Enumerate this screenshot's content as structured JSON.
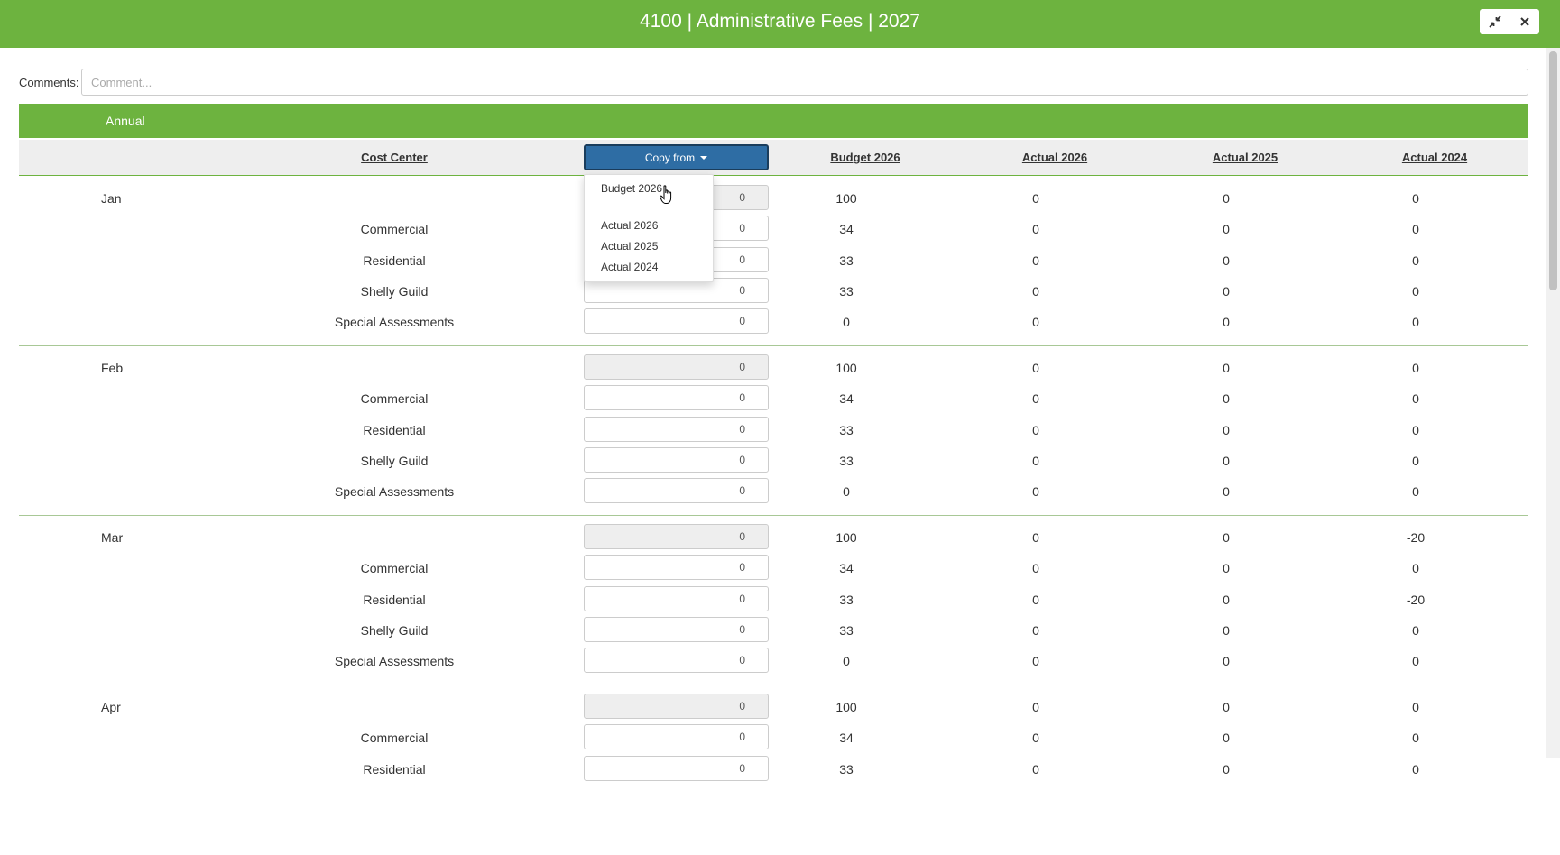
{
  "header": {
    "title": "4100 | Administrative Fees | 2027",
    "bg_color": "#6db33f",
    "minimize_icon": "compress-icon",
    "close_icon": "close-icon"
  },
  "comments": {
    "label": "Comments:",
    "placeholder": "Comment...",
    "value": ""
  },
  "section": {
    "label": "Annual"
  },
  "columns": {
    "cost_center": "Cost Center",
    "copy_from": "Copy from",
    "budget_2026": "Budget 2026",
    "actual_2026": "Actual 2026",
    "actual_2025": "Actual 2025",
    "actual_2024": "Actual 2024"
  },
  "copy_dropdown": {
    "items": [
      "Budget 2026",
      "Actual 2026",
      "Actual 2025",
      "Actual 2024"
    ]
  },
  "months": [
    {
      "month": "Jan",
      "rows": [
        {
          "cc": "",
          "input": "0",
          "b2026": "100",
          "a2026": "0",
          "a2025": "0",
          "a2024": "0"
        },
        {
          "cc": "Commercial",
          "input": "0",
          "b2026": "34",
          "a2026": "0",
          "a2025": "0",
          "a2024": "0"
        },
        {
          "cc": "Residential",
          "input": "0",
          "b2026": "33",
          "a2026": "0",
          "a2025": "0",
          "a2024": "0"
        },
        {
          "cc": "Shelly Guild",
          "input": "0",
          "b2026": "33",
          "a2026": "0",
          "a2025": "0",
          "a2024": "0"
        },
        {
          "cc": "Special Assessments",
          "input": "0",
          "b2026": "0",
          "a2026": "0",
          "a2025": "0",
          "a2024": "0"
        }
      ]
    },
    {
      "month": "Feb",
      "rows": [
        {
          "cc": "",
          "input": "0",
          "b2026": "100",
          "a2026": "0",
          "a2025": "0",
          "a2024": "0"
        },
        {
          "cc": "Commercial",
          "input": "0",
          "b2026": "34",
          "a2026": "0",
          "a2025": "0",
          "a2024": "0"
        },
        {
          "cc": "Residential",
          "input": "0",
          "b2026": "33",
          "a2026": "0",
          "a2025": "0",
          "a2024": "0"
        },
        {
          "cc": "Shelly Guild",
          "input": "0",
          "b2026": "33",
          "a2026": "0",
          "a2025": "0",
          "a2024": "0"
        },
        {
          "cc": "Special Assessments",
          "input": "0",
          "b2026": "0",
          "a2026": "0",
          "a2025": "0",
          "a2024": "0"
        }
      ]
    },
    {
      "month": "Mar",
      "rows": [
        {
          "cc": "",
          "input": "0",
          "b2026": "100",
          "a2026": "0",
          "a2025": "0",
          "a2024": "-20"
        },
        {
          "cc": "Commercial",
          "input": "0",
          "b2026": "34",
          "a2026": "0",
          "a2025": "0",
          "a2024": "0"
        },
        {
          "cc": "Residential",
          "input": "0",
          "b2026": "33",
          "a2026": "0",
          "a2025": "0",
          "a2024": "-20"
        },
        {
          "cc": "Shelly Guild",
          "input": "0",
          "b2026": "33",
          "a2026": "0",
          "a2025": "0",
          "a2024": "0"
        },
        {
          "cc": "Special Assessments",
          "input": "0",
          "b2026": "0",
          "a2026": "0",
          "a2025": "0",
          "a2024": "0"
        }
      ]
    },
    {
      "month": "Apr",
      "rows": [
        {
          "cc": "",
          "input": "0",
          "b2026": "100",
          "a2026": "0",
          "a2025": "0",
          "a2024": "0"
        },
        {
          "cc": "Commercial",
          "input": "0",
          "b2026": "34",
          "a2026": "0",
          "a2025": "0",
          "a2024": "0"
        },
        {
          "cc": "Residential",
          "input": "0",
          "b2026": "33",
          "a2026": "0",
          "a2025": "0",
          "a2024": "0"
        }
      ]
    }
  ]
}
